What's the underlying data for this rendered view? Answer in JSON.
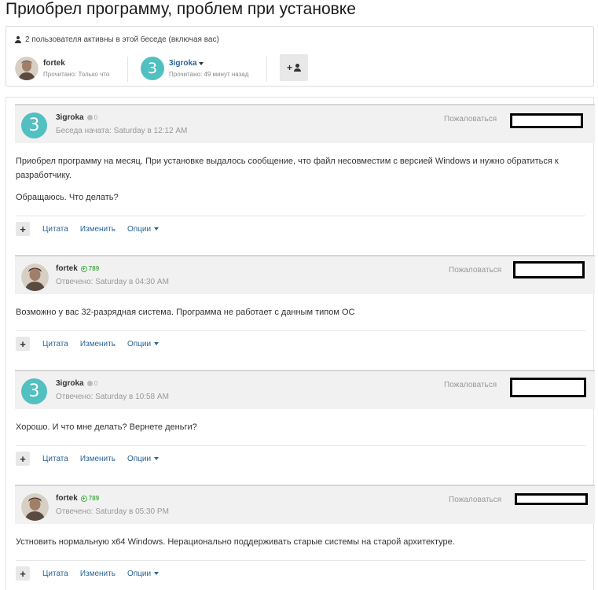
{
  "page": {
    "title": "Приобрел программу, проблем при установке"
  },
  "participants": {
    "active_text": "2 пользователя активны в этой беседе (включая вас)",
    "users": [
      {
        "name": "fortek",
        "status": "Прочитано: Только что"
      },
      {
        "name": "3igroka",
        "status": "Прочитано: 49 минут назад",
        "avatar_letter": "3"
      }
    ],
    "add_button_icon": "add-user-icon"
  },
  "labels": {
    "report": "Пожаловаться",
    "quote": "Цитата",
    "edit": "Изменить",
    "options": "Опции",
    "plus": "+"
  },
  "posts": [
    {
      "author": "3igroka",
      "reputation": "0",
      "avatar_letter": "3",
      "date": "Беседа начата: Saturday в 12:12 AM",
      "paragraphs": [
        "Приобрел программу на месяц. При установке выдалось сообщение, что файл несовместим с версией Windows и нужно обратиться к разработчику.",
        "Обращаюсь. Что делать?"
      ]
    },
    {
      "author": "fortek",
      "reputation": "789",
      "date": "Отвечено: Saturday в 04:30 AM",
      "paragraphs": [
        "Возможно у вас 32-разрядная система. Программа не работает с данным типом ОС"
      ]
    },
    {
      "author": "3igroka",
      "reputation": "0",
      "avatar_letter": "3",
      "date": "Отвечено: Saturday в 10:58 AM",
      "paragraphs": [
        "Хорошо. И что мне делать? Вернете деньги?"
      ]
    },
    {
      "author": "fortek",
      "reputation": "789",
      "date": "Отвечено: Saturday в 05:30 PM",
      "paragraphs": [
        "Устновить нормальную x64 Windows. Нерационально поддерживать старые системы на старой архитектуре."
      ]
    }
  ],
  "colors": {
    "accent_teal": "#52bfc1",
    "link_blue": "#2a6496",
    "rep_green": "#4caf50"
  }
}
